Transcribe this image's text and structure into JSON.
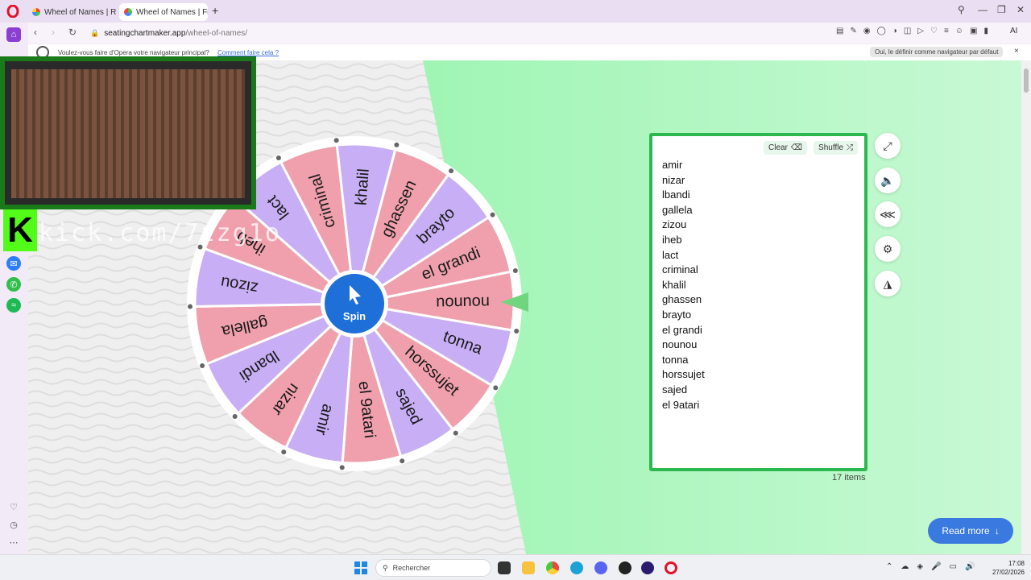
{
  "browser": {
    "tabs": [
      {
        "title": "Wheel of Names | Random"
      },
      {
        "title": "Wheel of Names | Free Ra"
      }
    ],
    "new_tab": "+",
    "url_host": "seatingchartmaker.app",
    "url_path": "/wheel-of-names/",
    "ai_label": "AI"
  },
  "notice": {
    "text": "Voulez-vous faire d'Opera votre navigateur principal?",
    "link": "Comment faire cela ?",
    "button": "Oui, le définir comme navigateur par défaut",
    "close": "×"
  },
  "overlay": {
    "kick_logo": "K",
    "kick_name": "kick.com/7zzg1o"
  },
  "wheel": {
    "spin_label": "Spin",
    "slice_colors": [
      "#f0a0ad",
      "#c8aef5"
    ],
    "slices": [
      "nounou",
      "tonna",
      "horssujet",
      "sajed",
      "el 9atari",
      "amir",
      "nizar",
      "lbandi",
      "gallela",
      "zizou",
      "iheb",
      "lact",
      "criminal",
      "khalil",
      "ghassen",
      "brayto",
      "el grandi"
    ]
  },
  "panel": {
    "clear_label": "Clear",
    "shuffle_label": "Shuffle",
    "entries": [
      "amir",
      "nizar",
      "lbandi",
      "gallela",
      "zizou",
      "iheb",
      "lact",
      "criminal",
      "khalil",
      "ghassen",
      "brayto",
      "el grandi",
      "nounou",
      "tonna",
      "horssujet",
      "sajed",
      "el 9atari"
    ],
    "count_label": "17 items"
  },
  "actions": {
    "read_more": "Read more"
  },
  "taskbar": {
    "search_placeholder": "Rechercher",
    "time": "17:08",
    "date": "27/02/2026"
  },
  "colors": {
    "accent_green": "#2cb84e",
    "bg_green": "#9ff5b4",
    "spin_blue": "#1f6fd8"
  }
}
